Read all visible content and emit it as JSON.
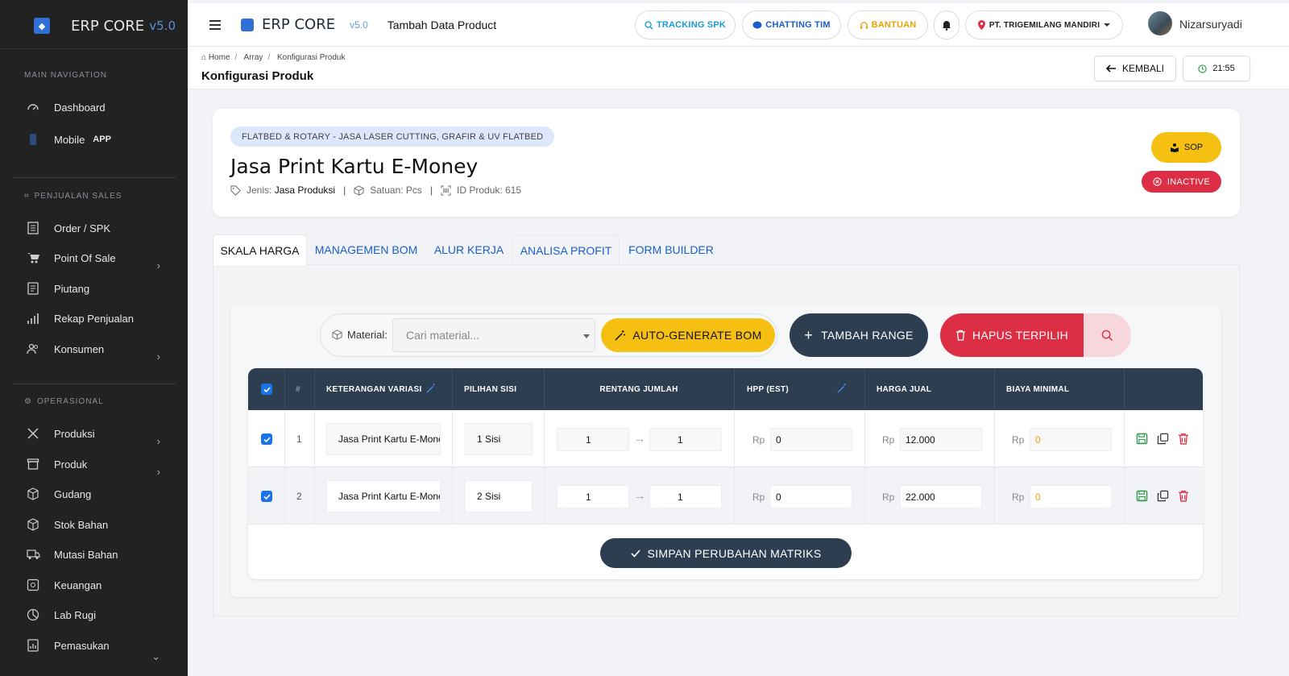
{
  "sidebar": {
    "brand": "ERP CORE",
    "version": "v5.0",
    "sections": {
      "main": "MAIN NAVIGATION",
      "sales": "PENJUALAN SALES",
      "ops": "OPERASIONAL"
    },
    "items": {
      "dashboard": "Dashboard",
      "mobile": "Mobile",
      "mobile_badge": "APP",
      "order": "Order / SPK",
      "pos": "Point Of Sale",
      "piutang": "Piutang",
      "rekap": "Rekap Penjualan",
      "konsumen": "Konsumen",
      "produksi": "Produksi",
      "produk": "Produk",
      "gudang": "Gudang",
      "stok": "Stok Bahan",
      "mutasi": "Mutasi Bahan",
      "keuangan": "Keuangan",
      "labrugi": "Lab Rugi",
      "pemasukan": "Pemasukan"
    }
  },
  "topbar": {
    "brand": "ERP CORE",
    "version": "v5.0",
    "page": "Tambah Data Product",
    "tracking": "TRACKING SPK",
    "chat": "CHATTING TIM",
    "help": "BANTUAN",
    "company": "PT. TRIGEMILANG MANDIRI",
    "user": "Nizarsuryadi",
    "colors": {
      "tracking": "#1a9bd7",
      "chat": "#1a5fc8",
      "help": "#e8a300",
      "pin": "#dc2f45"
    }
  },
  "breadcrumb": {
    "home": "Home",
    "array": "Array",
    "current": "Konfigurasi Produk"
  },
  "page_title": "Konfigurasi Produk",
  "back_label": "KEMBALI",
  "clock": "21:55",
  "product": {
    "category": "FLATBED & ROTARY - JASA LASER CUTTING, GRAFIR & UV FLATBED",
    "name": "Jasa Print Kartu E-Money",
    "jenis_label": "Jenis:",
    "jenis": "Jasa Produksi",
    "satuan_label": "Satuan: Pcs",
    "id_label": "ID Produk: 615",
    "sop": "SOP",
    "status": "INACTIVE"
  },
  "tabs": [
    "SKALA HARGA",
    "MANAGEMEN BOM",
    "ALUR KERJA",
    "ANALISA PROFIT",
    "FORM BUILDER"
  ],
  "toolbar": {
    "material_label": "Material:",
    "material_placeholder": "Cari material...",
    "auto_bom": "AUTO-GENERATE BOM",
    "add_range": "TAMBAH RANGE",
    "delete_selected": "HAPUS TERPILIH"
  },
  "table": {
    "headers": {
      "num": "#",
      "ket": "KETERANGAN VARIASI",
      "sisi": "PILIHAN SISI",
      "rentang": "RENTANG JUMLAH",
      "hpp": "HPP (EST)",
      "harga": "HARGA JUAL",
      "biaya": "BIAYA MINIMAL"
    },
    "currency": "Rp",
    "rows": [
      {
        "no": "1",
        "ket": "Jasa Print Kartu E-Money",
        "sisi": "1 Sisi",
        "min": "1",
        "max": "1",
        "hpp": "0",
        "harga": "12.000",
        "biaya": "0"
      },
      {
        "no": "2",
        "ket": "Jasa Print Kartu E-Money",
        "sisi": "2 Sisi",
        "min": "1",
        "max": "1",
        "hpp": "0",
        "harga": "22.000",
        "biaya": "0"
      }
    ]
  },
  "save_matrix": "SIMPAN PERUBAHAN MATRIKS"
}
